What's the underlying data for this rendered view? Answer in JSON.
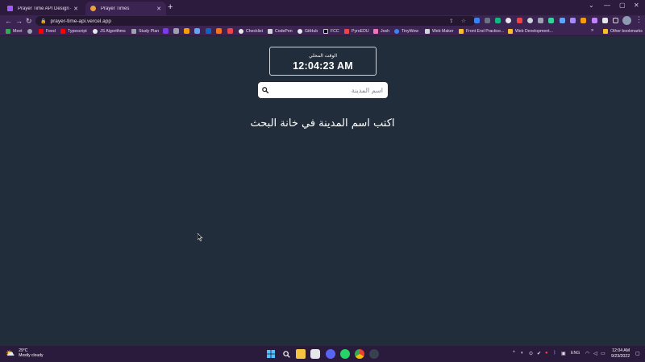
{
  "browser": {
    "tabs": [
      {
        "title": "Prayer Time API Design – Figma",
        "active": false
      },
      {
        "title": "Prayer Times",
        "active": true
      }
    ],
    "url": "prayer-time-api.vercel.app",
    "bookmarks": [
      "Meet",
      "Feed",
      "Typescript",
      "JS Algorithms",
      "Study Plan",
      "Checklist",
      "CodePen",
      "GitHub",
      "FCC",
      "PyroEDU",
      "Josh",
      "TinyWow",
      "Web Maker",
      "Front End Practice...",
      "Web Development..."
    ],
    "other_bookmarks": "Other bookmarks"
  },
  "app": {
    "clock_label": "الوقت المحلي",
    "clock_time": "12:04:23 AM",
    "search_placeholder": "اسم المدينة",
    "hint": "اكتب اسم المدينة في خانة البحث"
  },
  "taskbar": {
    "weather_temp": "29°C",
    "weather_desc": "Mostly cloudy",
    "language": "ENG",
    "time": "12:04 AM",
    "date": "9/23/2022"
  },
  "colors": {
    "page_bg": "#222d3b",
    "chrome_bg": "#3c2452",
    "tabstrip_bg": "#2d1b3d",
    "taskbar_bg": "#2a1a3c"
  }
}
